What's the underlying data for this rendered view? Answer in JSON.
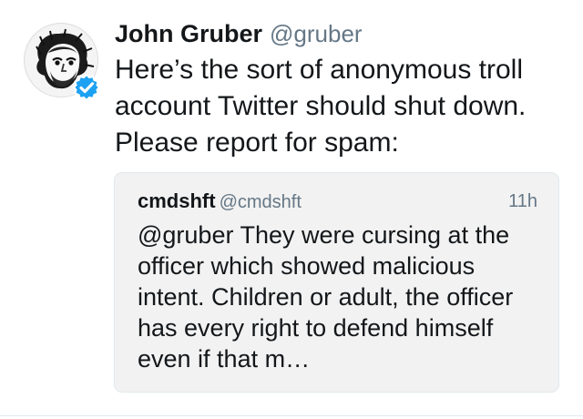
{
  "tweet": {
    "author": {
      "display_name": "John Gruber",
      "handle": "@gruber",
      "avatar_icon": "avatar-illustration-icon",
      "verified_icon": "verified-badge-icon",
      "verified_color": "#1da1f2"
    },
    "text": "Here’s the sort of anonymous troll account Twitter should shut down. Please report for spam:",
    "quoted_tweet": {
      "display_name": "cmdshft",
      "handle": "@cmdshft",
      "timestamp": "11h",
      "text": "@gruber They were cursing at the officer which showed malicious intent. Children or adult, the officer has every right to defend himself even if that m…"
    }
  },
  "colors": {
    "text_primary": "#14171a",
    "text_secondary": "#657786",
    "quote_background": "#f2f2f2",
    "accent": "#1da1f2"
  }
}
